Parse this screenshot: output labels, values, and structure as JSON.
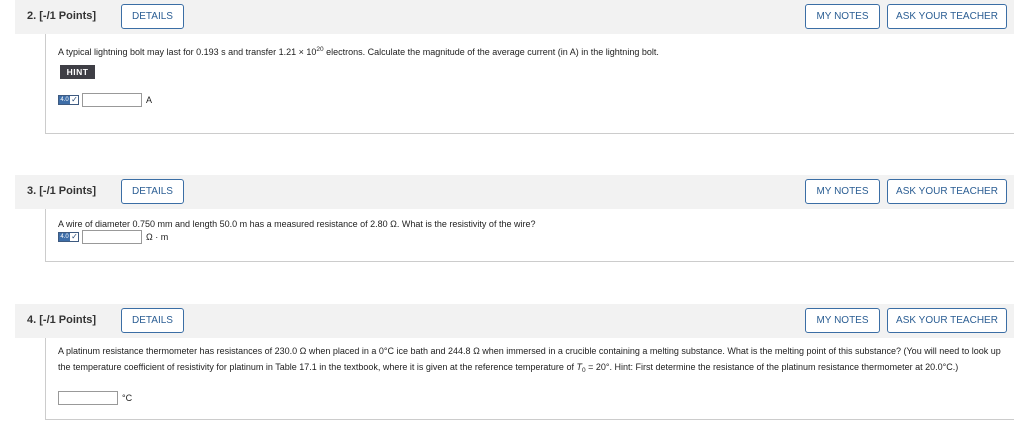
{
  "questions": [
    {
      "number": "2.",
      "points": "[-/1 Points]",
      "details_label": "DETAILS",
      "my_notes_label": "MY NOTES",
      "ask_teacher_label": "ASK YOUR TEACHER",
      "text_before_sup": "A typical lightning bolt may last for 0.193 s and transfer 1.21 × 10",
      "text_sup": "20",
      "text_after_sup": " electrons. Calculate the magnitude of the average current (in A) in the lightning bolt.",
      "hint_label": "HINT",
      "version_badge": "4.0",
      "answer_value": "",
      "unit": "A"
    },
    {
      "number": "3.",
      "points": "[-/1 Points]",
      "details_label": "DETAILS",
      "my_notes_label": "MY NOTES",
      "ask_teacher_label": "ASK YOUR TEACHER",
      "text": "A wire of diameter 0.750 mm and length 50.0 m has a measured resistance of 2.80 Ω. What is the resistivity of the wire?",
      "version_badge": "4.0",
      "answer_value": "",
      "unit": "Ω · m"
    },
    {
      "number": "4.",
      "points": "[-/1 Points]",
      "details_label": "DETAILS",
      "my_notes_label": "MY NOTES",
      "ask_teacher_label": "ASK YOUR TEACHER",
      "text_part1": "A platinum resistance thermometer has resistances of 230.0 Ω when placed in a 0°C ice bath and 244.8 Ω when immersed in a crucible containing a melting substance. What is the melting point of this substance? (You will need to look up the temperature coefficient of resistivity for platinum in Table 17.1 in the textbook, where it is given at the reference temperature of ",
      "text_var": "T",
      "text_sub": "0",
      "text_part2": " = 20°. Hint: First determine the resistance of the platinum resistance thermometer at 20.0°C.)",
      "answer_value": "",
      "unit": "°C"
    }
  ]
}
